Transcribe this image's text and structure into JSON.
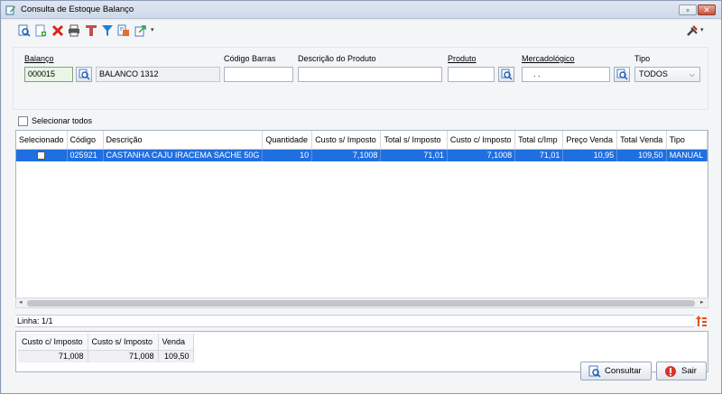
{
  "window": {
    "title": "Consulta de Estoque Balanço",
    "minimize_glyph": "▫",
    "close_glyph": "✕"
  },
  "toolbar": {
    "icons": [
      "search-document-icon",
      "new-document-icon",
      "delete-icon",
      "print-icon",
      "tool-icon",
      "filter-icon",
      "report-icon",
      "export-icon"
    ],
    "dropdown_glyph": "▾",
    "settings_icon": "tools-icon"
  },
  "filters": {
    "balanco_label": "Balanço",
    "balanco_value": "000015",
    "balanco_desc": "BALANCO 1312",
    "codigo_barras_label": "Código Barras",
    "codigo_barras_value": "",
    "descricao_label": "Descrição do Produto",
    "descricao_value": "",
    "produto_label": "Produto",
    "produto_value": "",
    "mercadologico_label": "Mercadológico",
    "mercadologico_value": ". .",
    "tipo_label": "Tipo",
    "tipo_value": "TODOS",
    "chevron": "⌵"
  },
  "select_all_label": "Selecionar todos",
  "grid": {
    "columns": [
      "Selecionado",
      "Código",
      "Descrição",
      "Quantidade",
      "Custo s/ Imposto",
      "Total s/ Imposto",
      "Custo c/ Imposto",
      "Total c/Imp",
      "Preço Venda",
      "Total Venda",
      "Tipo"
    ],
    "rows": [
      {
        "selecionado": false,
        "codigo": "025921",
        "descricao": "CASTANHA CAJU IRACEMA SACHE 50G",
        "quantidade": "10",
        "custo_s_imposto": "7,1008",
        "total_s_imposto": "71,01",
        "custo_c_imposto": "7,1008",
        "total_c_imp": "71,01",
        "preco_venda": "10,95",
        "total_venda": "109,50",
        "tipo": "MANUAL"
      }
    ],
    "scroll_left": "◂",
    "scroll_right": "▸"
  },
  "status": {
    "linha": "Linha: 1/1"
  },
  "totals": {
    "headers": [
      "Custo c/ Imposto",
      "Custo s/ Imposto",
      "Venda"
    ],
    "values": [
      "71,008",
      "71,008",
      "109,50"
    ]
  },
  "buttons": {
    "consultar": "Consultar",
    "sair": "Sair"
  },
  "colors": {
    "selection": "#1f6fe0",
    "highlight_field": "#e9f6e6",
    "exit_red": "#d9342b"
  }
}
